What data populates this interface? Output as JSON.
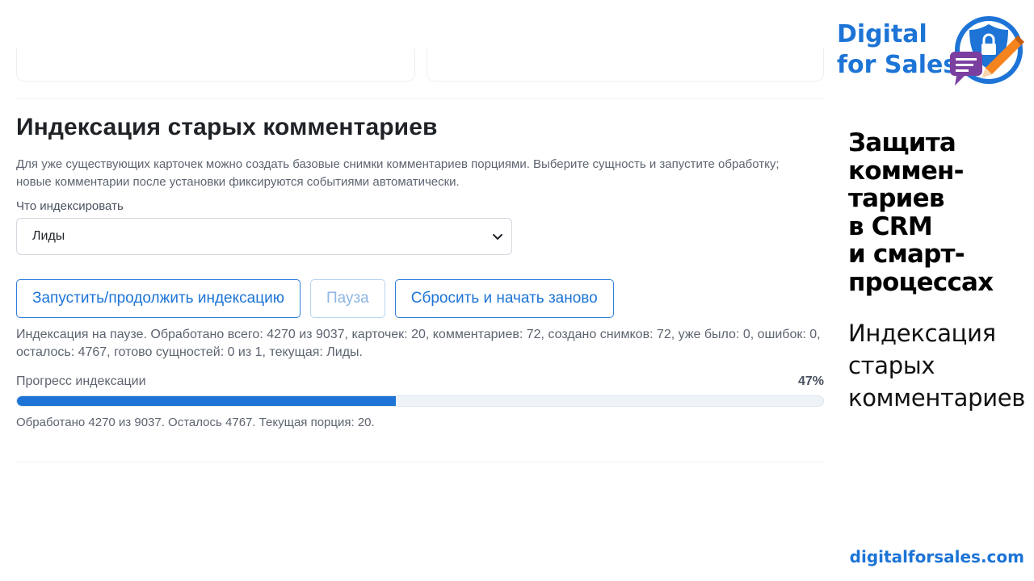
{
  "section": {
    "title": "Индексация старых комментариев",
    "description": "Для уже существующих карточек можно создать базовые снимки комментариев порциями. Выберите сущность и запустите обработку; новые комментарии после установки фиксируются событиями автоматически.",
    "entity_label": "Что индексировать",
    "entity_selected": "Лиды"
  },
  "buttons": {
    "start": "Запустить/продолжить индексацию",
    "pause": "Пауза",
    "reset": "Сбросить и начать заново"
  },
  "status_text": "Индексация на паузе. Обработано всего: 4270 из 9037, карточек: 20, комментариев: 72, создано снимков: 72, уже было: 0, ошибок: 0, осталось: 4767, готово сущностей: 0 из 1, текущая: Лиды.",
  "progress": {
    "label": "Прогресс индексации",
    "percent_text": "47%",
    "fraction": 0.47,
    "footer": "Обработано 4270 из 9037. Осталось 4767. Текущая порция: 20."
  },
  "brand": {
    "line1": "Digital",
    "line2": "for Sales",
    "side_title": "Защита\nкоммен-\nтариев\nв CRM\nи смарт-\nпроцессах",
    "side_subtitle": "Индексация\nстарых\nкомментариев",
    "website": "digitalforsales.com"
  },
  "colors": {
    "accent": "#1d74d6",
    "logo_orange": "#f5841f",
    "logo_purple": "#7b3fa0"
  },
  "icons": {
    "select_chevron": "chevron-down-icon",
    "logo": "shield-lock-pencil-chat-logo"
  }
}
